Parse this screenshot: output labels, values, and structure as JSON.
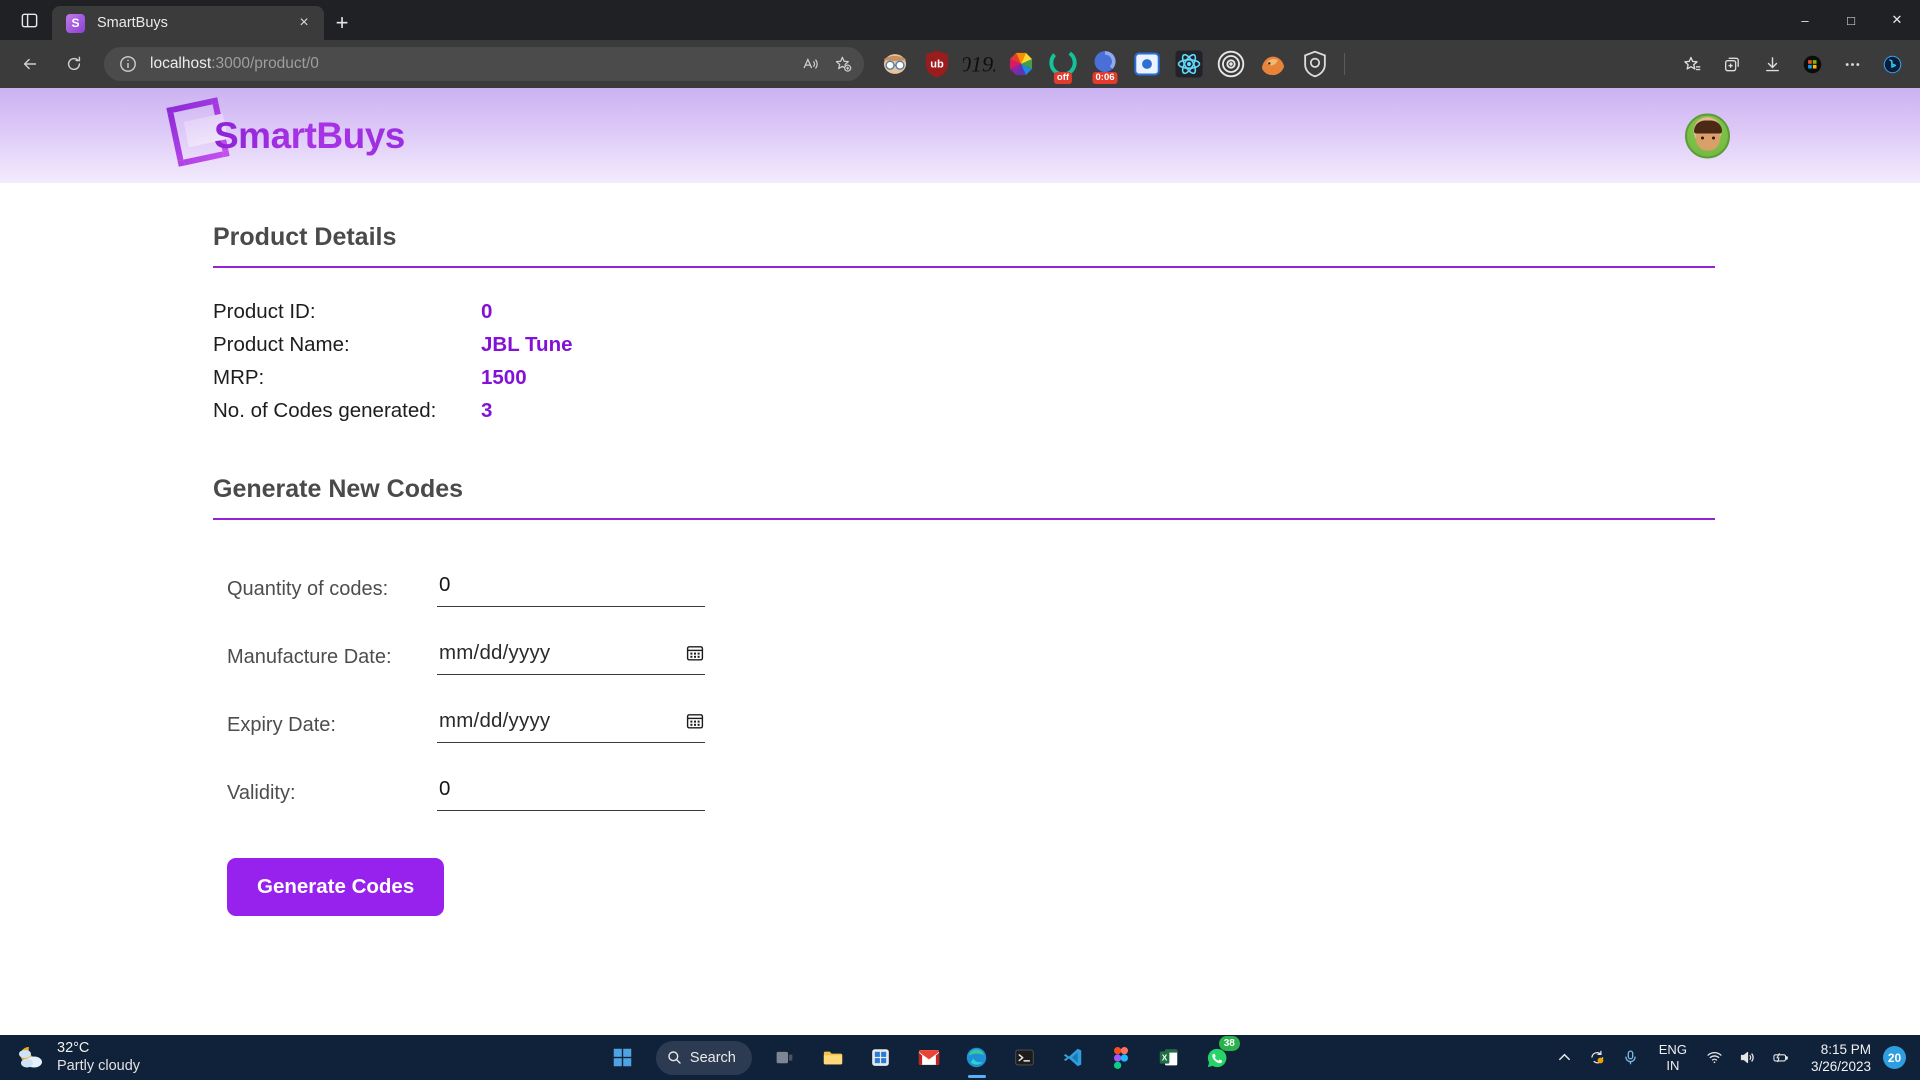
{
  "browser": {
    "tab": {
      "title": "SmartBuys",
      "favicon_letter": "S",
      "close_label": "×"
    },
    "newtab_label": "+",
    "tab_list_icon": "tab-list-icon",
    "url": {
      "host": "localhost",
      "path": ":3000/product/0",
      "full": "localhost:3000/product/0"
    },
    "nav": {
      "back": "←",
      "refresh": "↻"
    },
    "window_controls": {
      "minimize": "–",
      "maximize": "□",
      "close": "✕"
    },
    "omnibox_actions": [
      {
        "name": "read-aloud-icon",
        "label": "A"
      },
      {
        "name": "add-favorite-icon",
        "label": "☆"
      }
    ],
    "extensions": [
      {
        "name": "bitwarden-extension-icon",
        "glyph": "👓",
        "badge": ""
      },
      {
        "name": "ublock-origin-extension-icon",
        "glyph": "ub",
        "badge": ""
      },
      {
        "name": "mathjax-extension-icon",
        "glyph": "ƒ?",
        "badge": ""
      },
      {
        "name": "colorzilla-extension-icon",
        "glyph": "",
        "badge": ""
      },
      {
        "name": "grammarly-extension-icon",
        "glyph": "G",
        "badge": "off"
      },
      {
        "name": "clockify-extension-icon",
        "glyph": "",
        "badge": "0:06"
      },
      {
        "name": "loom-extension-icon",
        "glyph": "",
        "badge": ""
      },
      {
        "name": "react-devtools-extension-icon",
        "glyph": "",
        "badge": ""
      },
      {
        "name": "target-extension-icon",
        "glyph": "",
        "badge": ""
      },
      {
        "name": "firefox-send-extension-icon",
        "glyph": "🦊",
        "badge": ""
      },
      {
        "name": "privacy-badger-extension-icon",
        "glyph": "",
        "badge": ""
      }
    ],
    "right_tray": [
      {
        "name": "favorites-icon"
      },
      {
        "name": "collections-icon"
      },
      {
        "name": "downloads-icon"
      },
      {
        "name": "microsoft-rewards-icon"
      },
      {
        "name": "settings-and-more-icon"
      },
      {
        "name": "bing-copilot-icon"
      }
    ]
  },
  "site": {
    "logo_text": "SmartBuys",
    "avatar_name": "user-avatar"
  },
  "product_details": {
    "heading": "Product Details",
    "rows": [
      {
        "label": "Product ID:",
        "value": "0"
      },
      {
        "label": "Product Name:",
        "value": "JBL Tune"
      },
      {
        "label": "MRP:",
        "value": "1500"
      },
      {
        "label": "No. of Codes generated:",
        "value": "3"
      }
    ]
  },
  "generate_section": {
    "heading": "Generate New Codes",
    "fields": [
      {
        "name": "quantity-of-codes",
        "label": "Quantity of codes:",
        "value": "0",
        "type": "number",
        "has_calendar": false
      },
      {
        "name": "manufacture-date",
        "label": "Manufacture Date:",
        "value": "",
        "placeholder": "mm/dd/yyyy",
        "type": "date",
        "has_calendar": true
      },
      {
        "name": "expiry-date",
        "label": "Expiry Date:",
        "value": "",
        "placeholder": "mm/dd/yyyy",
        "type": "date",
        "has_calendar": true
      },
      {
        "name": "validity",
        "label": "Validity:",
        "value": "0",
        "type": "number",
        "has_calendar": false
      }
    ],
    "submit_label": "Generate Codes"
  },
  "colors": {
    "accent": "#9722d6",
    "value_purple": "#8311d6",
    "button": "#9722ee",
    "header_gradient_top": "#cbb2f2",
    "header_gradient_bottom": "#f3ecfd"
  },
  "taskbar": {
    "weather": {
      "temperature": "32°C",
      "condition": "Partly cloudy"
    },
    "search_label": "Search",
    "items": [
      {
        "name": "start-button"
      },
      {
        "name": "task-view-button"
      },
      {
        "name": "file-explorer-button"
      },
      {
        "name": "microsoft-store-button"
      },
      {
        "name": "gmail-button"
      },
      {
        "name": "edge-button"
      },
      {
        "name": "terminal-button"
      },
      {
        "name": "vscode-button"
      },
      {
        "name": "figma-button"
      },
      {
        "name": "excel-button"
      },
      {
        "name": "whatsapp-button",
        "badge": "38"
      }
    ],
    "tray": {
      "chevron": "∧",
      "language": {
        "line1": "ENG",
        "line2": "IN"
      },
      "time": "8:15 PM",
      "date": "3/26/2023",
      "notification_count": "20"
    }
  }
}
